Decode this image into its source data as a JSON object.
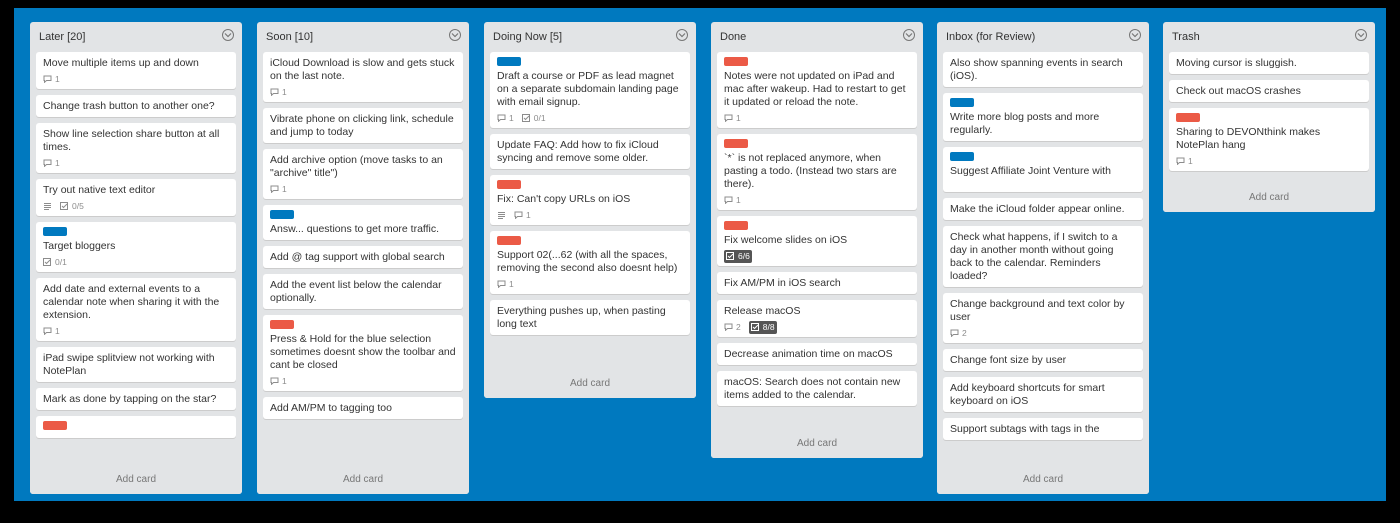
{
  "lists": [
    {
      "title": "Later [20]",
      "add_card": "Add card",
      "cards": [
        {
          "text": "Move multiple items up and down",
          "comments": "1"
        },
        {
          "text": "Change trash button to another one?"
        },
        {
          "text": "Show line selection share button at all times.",
          "comments": "1"
        },
        {
          "text": "Try out native text editor",
          "description": true,
          "checklist": "0/5"
        },
        {
          "label": "blue",
          "text": "Target bloggers",
          "checklist": "0/1"
        },
        {
          "text": "Add date and external events to a calendar note when sharing it with the extension.",
          "comments": "1"
        },
        {
          "text": "iPad swipe splitview not working with NotePlan"
        },
        {
          "text": "Mark as done by tapping on the star?"
        },
        {
          "label": "red",
          "text": ""
        }
      ]
    },
    {
      "title": "Soon [10]",
      "add_card": "Add card",
      "cards": [
        {
          "text": "iCloud Download is slow and gets stuck on the last note.",
          "comments": "1"
        },
        {
          "text": "Vibrate phone on clicking link, schedule and jump to today"
        },
        {
          "text": "Add archive option (move tasks to an \"archive\" title\")",
          "comments": "1"
        },
        {
          "label": "blue",
          "text": "Answ... questions to get more traffic."
        },
        {
          "text": "Add @ tag support with global search"
        },
        {
          "text": "Add the event list below the calendar optionally."
        },
        {
          "label": "red",
          "text": "Press & Hold for the blue selection sometimes doesnt show the toolbar and cant be closed",
          "comments": "1"
        },
        {
          "text": "Add AM/PM to tagging too"
        }
      ]
    },
    {
      "title": "Doing Now [5]",
      "add_card": "Add card",
      "cards": [
        {
          "label": "blue",
          "text": "Draft a course or PDF as lead magnet on a separate subdomain landing page with email signup.",
          "comments": "1",
          "checklist": "0/1"
        },
        {
          "text": "Update FAQ: Add how to fix iCloud syncing and remove some older."
        },
        {
          "label": "red",
          "text": "Fix: Can't copy URLs on iOS",
          "description": true,
          "comments": "1"
        },
        {
          "label": "red",
          "text": "Support 02(...62 (with all the spaces, removing the second also doesnt help)",
          "comments": "1"
        },
        {
          "text": "Everything pushes up, when pasting long text"
        }
      ]
    },
    {
      "title": "Done",
      "add_card": "Add card",
      "cards": [
        {
          "label": "red",
          "text": "Notes were not updated on iPad and mac after wakeup. Had to restart to get it updated or reload the note.",
          "comments": "1"
        },
        {
          "label": "red",
          "text": "`*` is not replaced anymore, when pasting a todo. (Instead two stars are there).",
          "comments": "1"
        },
        {
          "label": "red",
          "text": "Fix welcome slides on iOS",
          "checklist_complete": "6/6"
        },
        {
          "text": "Fix AM/PM in iOS search"
        },
        {
          "text": "Release macOS",
          "comments": "2",
          "checklist_complete": "8/8"
        },
        {
          "text": "Decrease animation time on macOS"
        },
        {
          "text": "macOS: Search does not contain new items added to the calendar."
        }
      ]
    },
    {
      "title": "Inbox (for Review)",
      "add_card": "Add card",
      "cards": [
        {
          "text": "Also show spanning events in search (iOS)."
        },
        {
          "label": "blue",
          "text": "Write more blog posts and more regularly."
        },
        {
          "label": "blue",
          "text": "Suggest Affiliate Joint Venture with"
        },
        {
          "text": "Make the iCloud folder appear online."
        },
        {
          "text": "Check what happens, if I switch to a day in another month without going back to the calendar. Reminders loaded?"
        },
        {
          "text": "Change background and text color by user",
          "comments": "2"
        },
        {
          "text": "Change font size by user"
        },
        {
          "text": "Add keyboard shortcuts for smart keyboard on iOS"
        },
        {
          "text": "Support subtags with tags in the"
        }
      ]
    },
    {
      "title": "Trash",
      "add_card": "Add card",
      "cards": [
        {
          "text": "Moving cursor is sluggish."
        },
        {
          "text": "Check out macOS crashes"
        },
        {
          "label": "red",
          "text": "Sharing to DEVONthink makes NotePlan hang",
          "comments": "1"
        }
      ]
    }
  ]
}
